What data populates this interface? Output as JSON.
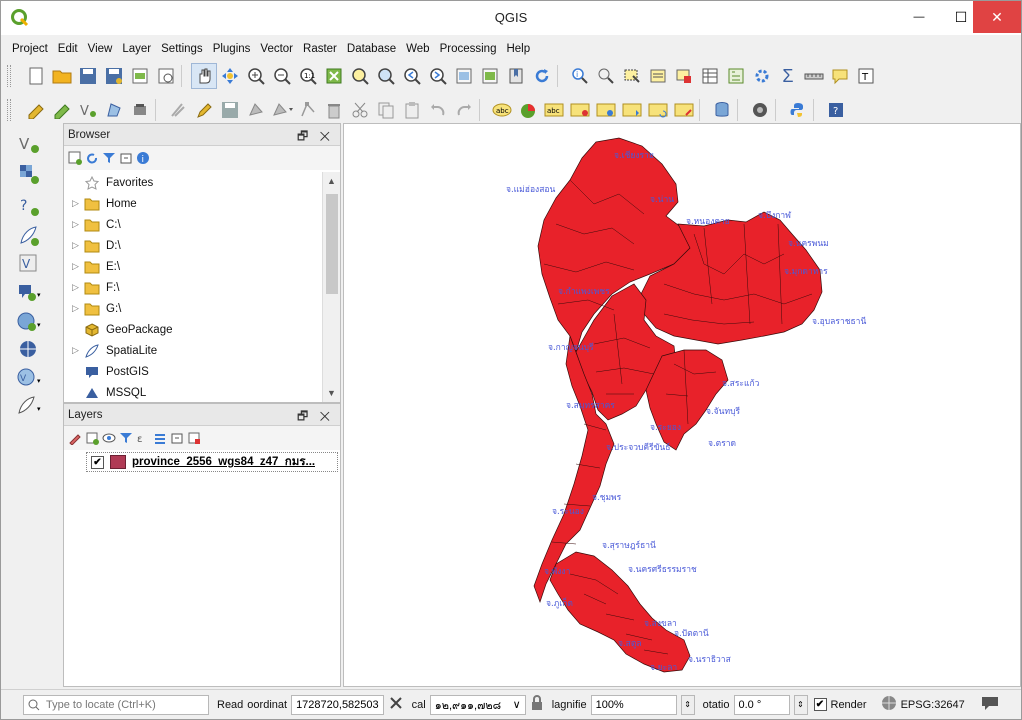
{
  "window": {
    "title": "QGIS",
    "logo_letter": "Q",
    "minimize": "—",
    "maximize": "☐",
    "close": "✕"
  },
  "menu": [
    "Project",
    "Edit",
    "View",
    "Layer",
    "Settings",
    "Plugins",
    "Vector",
    "Raster",
    "Database",
    "Web",
    "Processing",
    "Help"
  ],
  "browser": {
    "title": "Browser",
    "items": [
      {
        "label": "Favorites",
        "icon": "star-icon",
        "arrow": ""
      },
      {
        "label": "Home",
        "icon": "folder-icon",
        "arrow": "▷"
      },
      {
        "label": "C:\\",
        "icon": "folder-icon",
        "arrow": "▷"
      },
      {
        "label": "D:\\",
        "icon": "folder-icon",
        "arrow": "▷"
      },
      {
        "label": "E:\\",
        "icon": "folder-icon",
        "arrow": "▷"
      },
      {
        "label": "F:\\",
        "icon": "folder-icon",
        "arrow": "▷"
      },
      {
        "label": "G:\\",
        "icon": "folder-icon",
        "arrow": "▷"
      },
      {
        "label": "GeoPackage",
        "icon": "geopackage-icon",
        "arrow": ""
      },
      {
        "label": "SpatiaLite",
        "icon": "spatialite-icon",
        "arrow": "▷"
      },
      {
        "label": "PostGIS",
        "icon": "postgis-icon",
        "arrow": ""
      },
      {
        "label": "MSSQL",
        "icon": "mssql-icon",
        "arrow": ""
      }
    ]
  },
  "layers": {
    "title": "Layers",
    "layer_name": "province_2556_wgs84_z47_กมร...",
    "checked": "✔",
    "swatch_color": "#b03a55"
  },
  "map": {
    "fill_color": "#e8222a",
    "labels": [
      {
        "text": "จ.เชียงราย"
      },
      {
        "text": "จ.แม่ฮ่องสอน"
      },
      {
        "text": "จ.น่าน"
      },
      {
        "text": "จ.หนองคาย"
      },
      {
        "text": "จ.บึงกาฬ"
      },
      {
        "text": "จ.นครพนม"
      },
      {
        "text": "จ.มุกดาหาร"
      },
      {
        "text": "จ.กำแพงเพชร"
      },
      {
        "text": "จ.อุบลราชธานี"
      },
      {
        "text": "จ.กาญจนบุรี"
      },
      {
        "text": "จ.สระแก้ว"
      },
      {
        "text": "จ.สมุทรสาคร"
      },
      {
        "text": "จ.จันทบุรี"
      },
      {
        "text": "จ.ระยอง"
      },
      {
        "text": "จ.ตราด"
      },
      {
        "text": "จ.ประจวบคีรีขันธ์"
      },
      {
        "text": "จ.ชุมพร"
      },
      {
        "text": "จ.ระนอง"
      },
      {
        "text": "จ.สุราษฎร์ธานี"
      },
      {
        "text": "จ.พังงา"
      },
      {
        "text": "จ.นครศรีธรรมราช"
      },
      {
        "text": "จ.ภูเก็ต"
      },
      {
        "text": "จ.สงขลา"
      },
      {
        "text": "จ.ปัตตานี"
      },
      {
        "text": "จ.นราธิวาส"
      },
      {
        "text": "จ.สตูล"
      },
      {
        "text": "จ.ยะลา"
      }
    ]
  },
  "status": {
    "locate_placeholder": "Type to locate (Ctrl+K)",
    "ready": "Read",
    "coordinate_label": "oordinat",
    "coordinate_value": "1728720,582503",
    "scale_label": "cal",
    "scale_value": "๑๒,๙๑๑,๗๒๘",
    "magnifier_label": "lagnifie",
    "magnifier_value": "100%",
    "rotation_label": "otatio",
    "rotation_value": "0.0 °",
    "render_checked": "✔",
    "render_label": "Render",
    "crs": "EPSG:32647"
  }
}
